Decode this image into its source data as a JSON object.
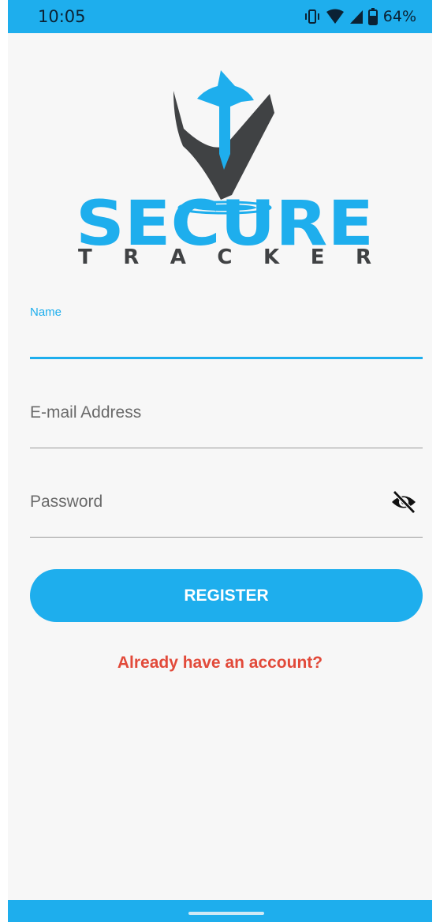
{
  "status_bar": {
    "time": "10:05",
    "battery": "64%",
    "icons": [
      "vibrate-icon",
      "wifi-icon",
      "signal-icon",
      "battery-icon"
    ]
  },
  "logo": {
    "word1": "SECURE",
    "word2": "TRACKER",
    "colors": {
      "blue": "#1eaeed",
      "dark": "#404244"
    }
  },
  "form": {
    "name": {
      "label": "Name",
      "value": ""
    },
    "email": {
      "placeholder": "E-mail Address",
      "value": ""
    },
    "password": {
      "placeholder": "Password",
      "value": "",
      "toggle_icon": "eye-off-icon"
    }
  },
  "actions": {
    "register_label": "REGISTER",
    "login_link": "Already have an account?"
  },
  "colors": {
    "accent": "#1eaeed",
    "link": "#e24a3a",
    "background": "#f7f7f7"
  }
}
